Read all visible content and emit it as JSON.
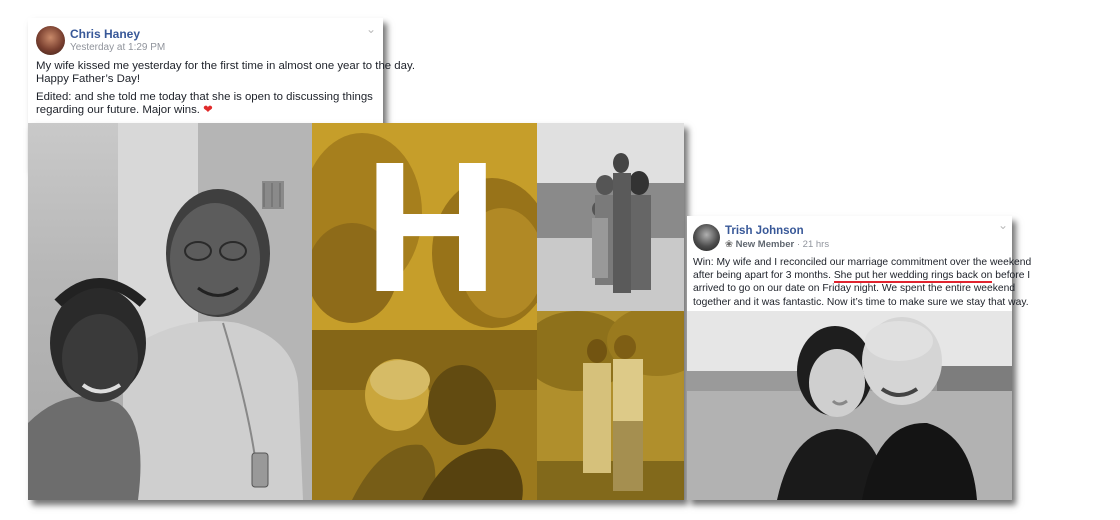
{
  "post1": {
    "author": "Chris Haney",
    "time": "Yesterday at 1:29 PM",
    "line1": "My wife kissed me yesterday for the first time in almost one year to the day.",
    "line2": "Happy Father’s Day!",
    "edit1": "Edited: and she told me today that she is open to discussing things",
    "edit2": "regarding our future. Major wins.",
    "heart_icon": "❤"
  },
  "logo": {
    "letter": "H"
  },
  "post2": {
    "author": "Trish Johnson",
    "badge": "New Member",
    "badge_icon": "❀",
    "time": "· 21 hrs",
    "l1": "Win: My wife and I reconciled our marriage commitment over the weekend",
    "l2_pre": "after being apart for 3 months. ",
    "l2_hl": "She put her wedding rings back on",
    "l2_post": " before I",
    "l3": "arrived to go on our date on Friday night. We spent the entire weekend",
    "l4": "together and it was fantastic. Now it’s time to make sure we stay that way."
  },
  "colors": {
    "link": "#385898",
    "highlight": "#e0242f",
    "gold": "#c9a224"
  }
}
